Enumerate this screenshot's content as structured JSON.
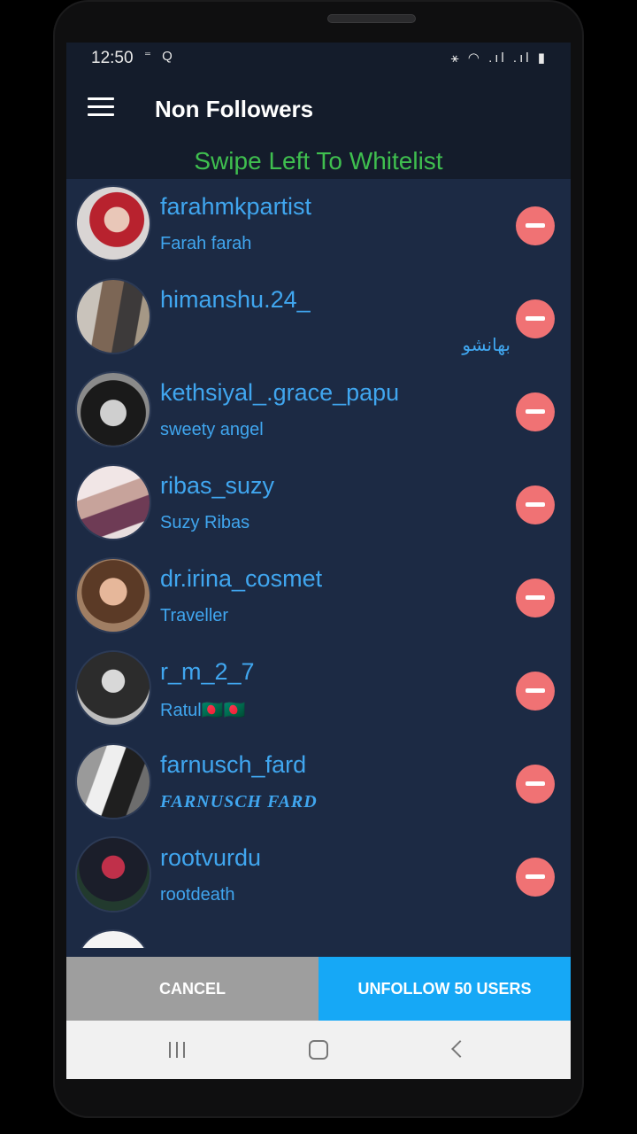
{
  "status_bar": {
    "time": "12:50",
    "left_icons": "⁼ Q",
    "right_icons": "⚹ ◠ .ıl .ıl ▮"
  },
  "app_bar": {
    "menu_icon": "hamburger-menu-icon",
    "title": "Non Followers"
  },
  "banner": "Swipe Left To Whitelist",
  "users": [
    {
      "username": "farahmkpartist",
      "name": "Farah farah",
      "style": "normal"
    },
    {
      "username": "himanshu.24_",
      "name": "بھانشو",
      "style": "rtl"
    },
    {
      "username": "kethsiyal_.grace_papu",
      "name": "sweety angel",
      "style": "normal"
    },
    {
      "username": "ribas_suzy",
      "name": "Suzy Ribas",
      "style": "normal"
    },
    {
      "username": "dr.irina_cosmet",
      "name": "Traveller",
      "style": "normal"
    },
    {
      "username": "r_m_2_7",
      "name": "Ratul🇧🇩🇧🇩",
      "style": "normal"
    },
    {
      "username": "farnusch_fard",
      "name": "FARNUSCH   FARD",
      "style": "italic"
    },
    {
      "username": "rootvurdu",
      "name": "rootdeath",
      "style": "normal"
    }
  ],
  "colors": {
    "background": "#1c2a44",
    "header": "#141c2b",
    "banner_text": "#3fbf4f",
    "link_blue": "#40a6ef",
    "remove_red": "#f07274",
    "cancel_gray": "#9e9e9e",
    "unfollow_blue": "#16a8f6"
  },
  "buttons": {
    "cancel": "CANCEL",
    "unfollow": "UNFOLLOW 50 USERS"
  },
  "nav_bar": {
    "recents_icon": "recents-icon",
    "home_icon": "home-icon",
    "back_icon": "back-icon"
  }
}
